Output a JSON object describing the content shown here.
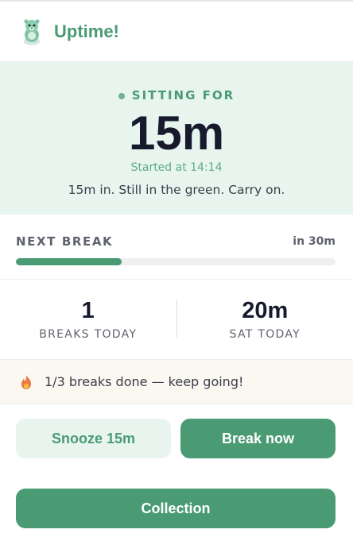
{
  "app": {
    "title": "Uptime!",
    "logo_icon": "otter-mascot-icon"
  },
  "status": {
    "label": "SITTING FOR",
    "duration": "15m",
    "started": "Started at 14:14",
    "message": "15m in. Still in the green. Carry on."
  },
  "next_break": {
    "label": "NEXT BREAK",
    "value": "in 30m",
    "progress_fraction": 0.33
  },
  "stats": [
    {
      "value": "1",
      "label": "BREAKS TODAY"
    },
    {
      "value": "20m",
      "label": "SAT TODAY"
    }
  ],
  "streak": {
    "icon": "flame-icon",
    "text": "1/3 breaks done — keep going!"
  },
  "actions": {
    "snooze_label": "Snooze 15m",
    "break_label": "Break now",
    "collection_label": "Collection"
  },
  "colors": {
    "accent": "#4a9a74",
    "accent_light": "#e8f5ef",
    "text_dark": "#161a2c",
    "muted": "#5f636e",
    "streak_bg": "#fbf8f2"
  }
}
